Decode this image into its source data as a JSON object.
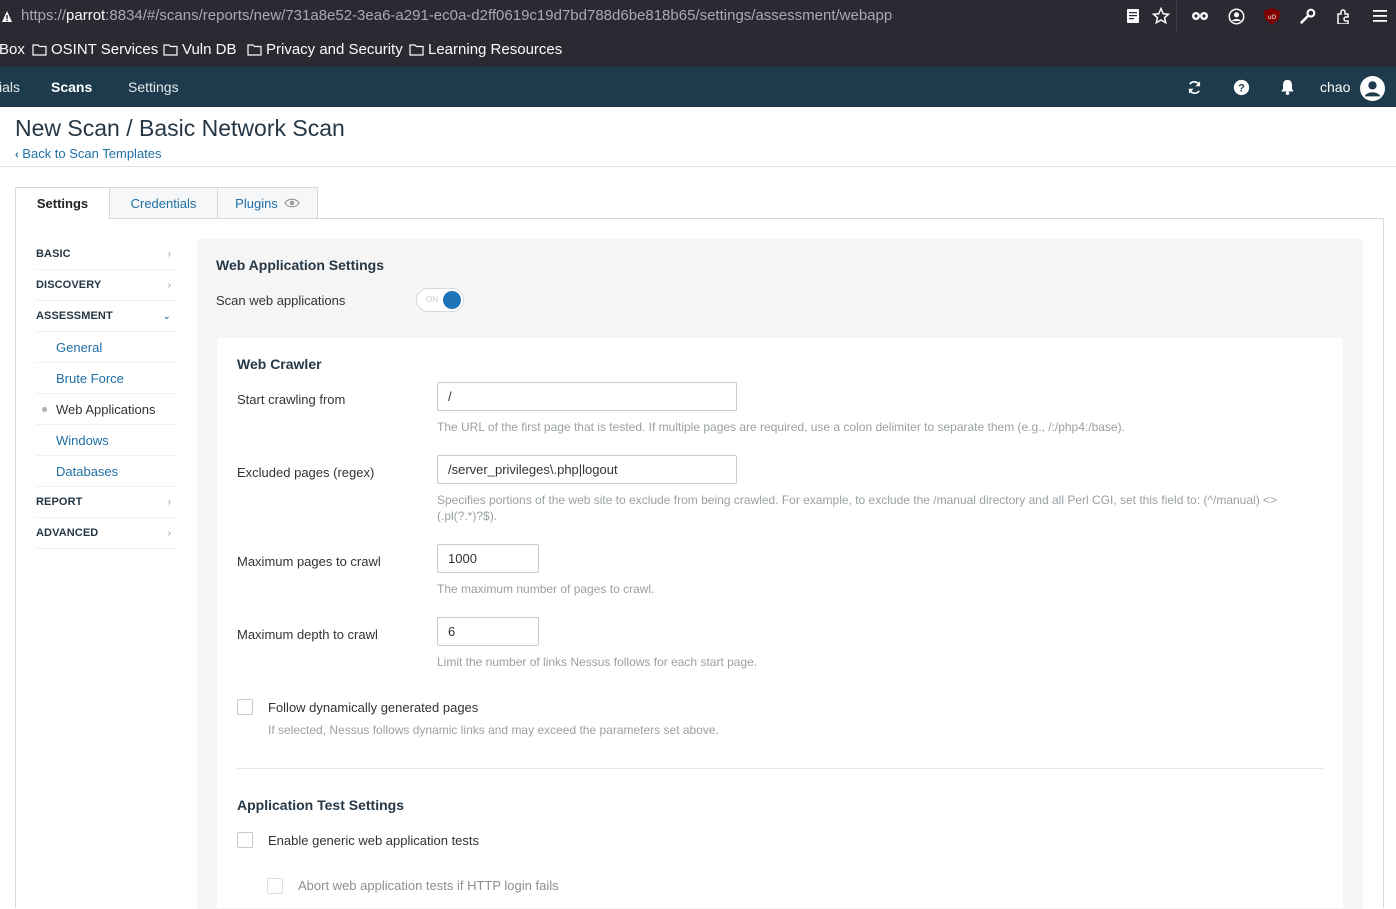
{
  "browser": {
    "url_prefix": "https://",
    "url_host": "parrot",
    "url_rest": ":8834/#/scans/reports/new/731a8e52-3ea6-a291-ec0a-d2ff0619c19d7bd788d6be818b65/settings/assessment/webapp",
    "icons": [
      "reader-icon",
      "bookmark-star-icon",
      "mask-icon",
      "account-icon",
      "ublock-icon",
      "wrench-icon",
      "extensions-icon",
      "menu-icon"
    ]
  },
  "bookmarks": {
    "partial": "Box",
    "items": [
      "OSINT Services",
      "Vuln DB",
      "Privacy and Security",
      "Learning Resources"
    ]
  },
  "app_nav": {
    "partial_item": "ials",
    "scans": "Scans",
    "settings": "Settings",
    "user": "chao"
  },
  "header": {
    "title": "New Scan / Basic Network Scan",
    "back_link": "Back to Scan Templates"
  },
  "tabs": {
    "settings": "Settings",
    "credentials": "Credentials",
    "plugins": "Plugins"
  },
  "sidebar": {
    "basic": "BASIC",
    "discovery": "DISCOVERY",
    "assessment": "ASSESSMENT",
    "general": "General",
    "brute_force": "Brute Force",
    "web_applications": "Web Applications",
    "windows": "Windows",
    "databases": "Databases",
    "report": "REPORT",
    "advanced": "ADVANCED"
  },
  "main": {
    "title": "Web Application Settings",
    "scan_web_label": "Scan web applications",
    "toggle_text": "ON",
    "crawler": {
      "title": "Web Crawler",
      "start_label": "Start crawling from",
      "start_value": "/",
      "start_help": "The URL of the first page that is tested. If multiple pages are required, use a colon delimiter to separate them (e.g., /:/php4:/base).",
      "excluded_label": "Excluded pages (regex)",
      "excluded_value": "/server_privileges\\.php|logout",
      "excluded_help": "Specifies portions of the web site to exclude from being crawled. For example, to exclude the /manual directory and all Perl CGI, set this field to: (^/manual) <> (.pl(?.*)?$).",
      "max_pages_label": "Maximum pages to crawl",
      "max_pages_value": "1000",
      "max_pages_help": "The maximum number of pages to crawl.",
      "max_depth_label": "Maximum depth to crawl",
      "max_depth_value": "6",
      "max_depth_help": "Limit the number of links Nessus follows for each start page.",
      "follow_label": "Follow dynamically generated pages",
      "follow_help": "If selected, Nessus follows dynamic links and may exceed the parameters set above."
    },
    "app_tests": {
      "title": "Application Test Settings",
      "enable_label": "Enable generic web application tests",
      "abort_label": "Abort web application tests if HTTP login fails"
    }
  }
}
